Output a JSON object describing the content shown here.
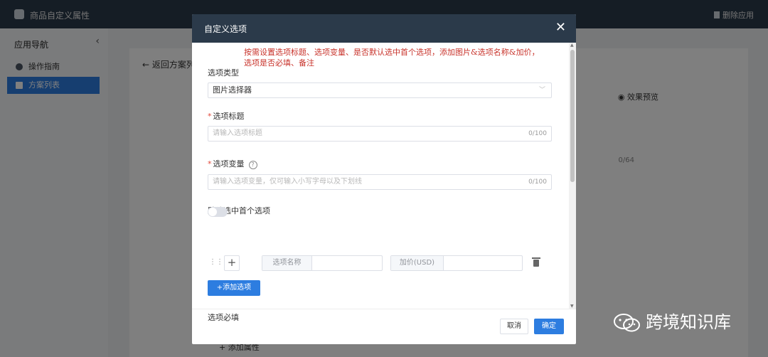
{
  "app": {
    "title": "商品自定义属性",
    "delete_app": "删除应用"
  },
  "sidebar": {
    "heading": "应用导航",
    "items": [
      {
        "label": "操作指南"
      },
      {
        "label": "方案列表"
      }
    ]
  },
  "background": {
    "back_link": "← 返回方案列",
    "preview": "效果预览",
    "add_field": "+ 添加属性",
    "pill": "0/64"
  },
  "modal": {
    "title": "自定义选项",
    "note": "按需设置选项标题、选项变量、是否默认选中首个选项，添加图片&选项名称&加价，选项是否必填、备注",
    "type_label": "选项类型",
    "type_value": "图片选择器",
    "title_label": "选项标题",
    "title_placeholder": "请输入选项标题",
    "title_counter": "0/100",
    "var_label": "选项变量",
    "var_placeholder": "请输入选项变量，仅可输入小写字母以及下划线",
    "var_counter": "0/100",
    "default_label": "默认选中首个选项",
    "default_on": false,
    "option_name_addon": "选项名称",
    "price_addon": "加价(USD)",
    "add_option": "+添加选项",
    "required_label": "选项必填",
    "cancel": "取消",
    "confirm": "确定"
  },
  "watermark": {
    "text": "跨境知识库"
  }
}
